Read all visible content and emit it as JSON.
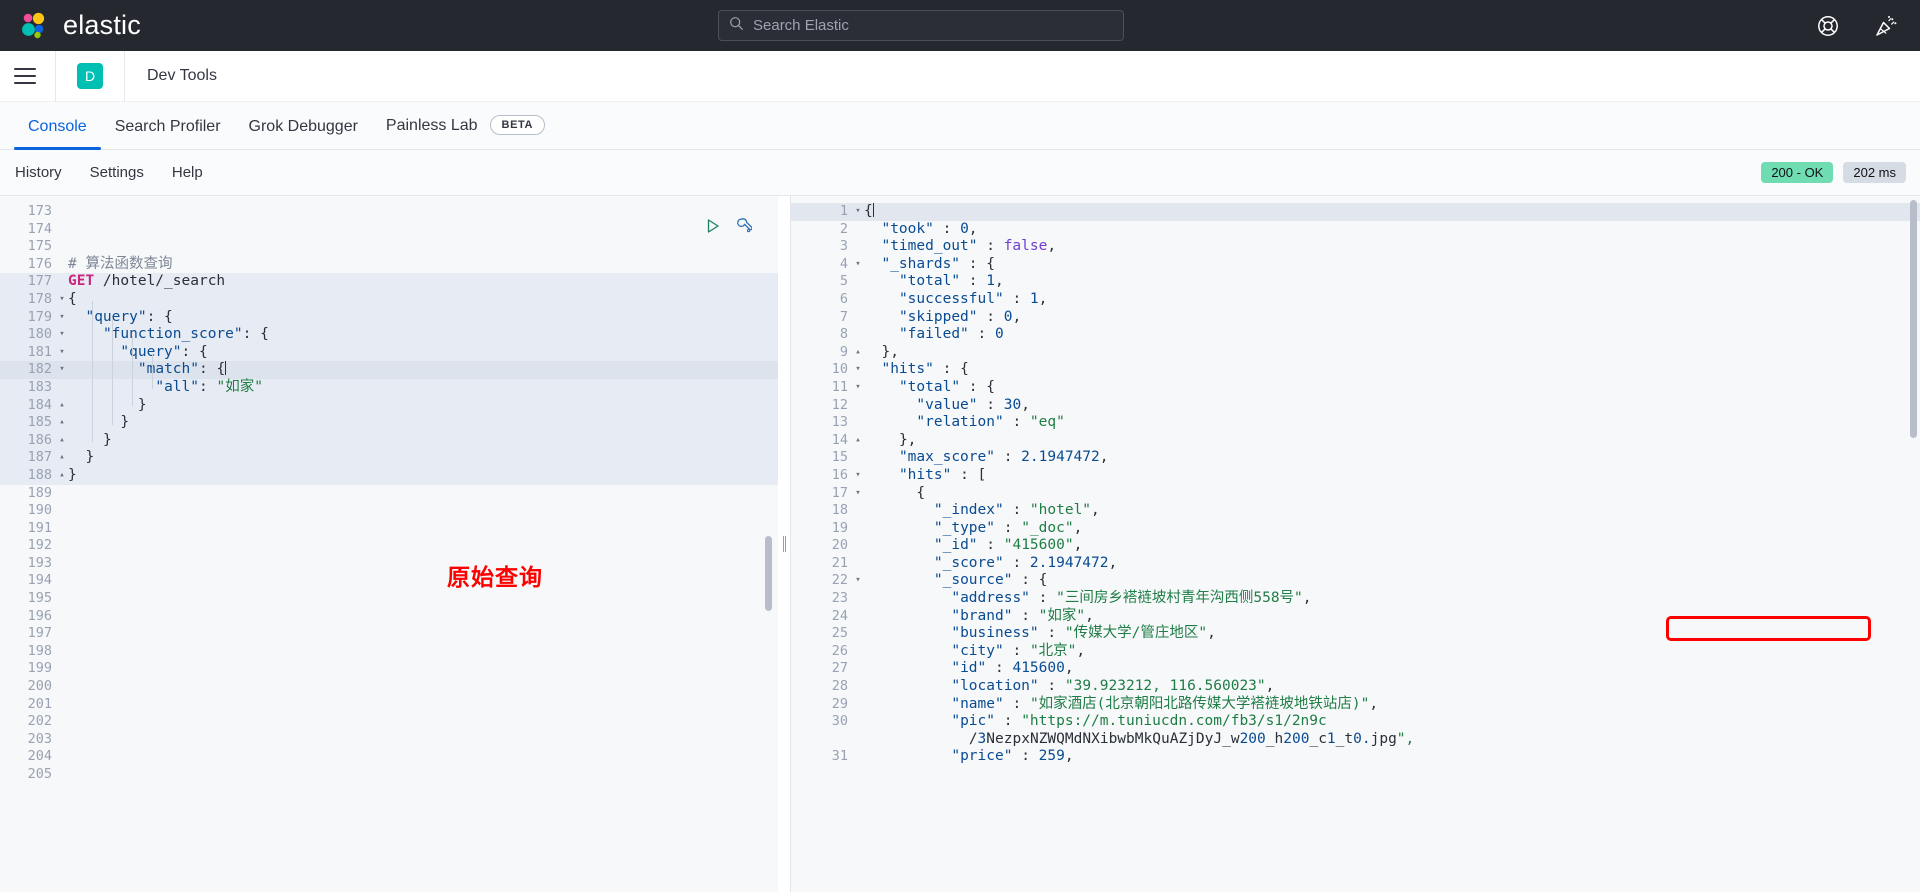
{
  "topbar": {
    "brand": "elastic",
    "search_placeholder": "Search Elastic",
    "search_value": "",
    "icons": [
      "help-lifebuoy-icon",
      "party-popper-icon"
    ]
  },
  "appbar": {
    "space_initial": "D",
    "title": "Dev Tools"
  },
  "tabs": [
    {
      "label": "Console",
      "active": true
    },
    {
      "label": "Search Profiler",
      "active": false
    },
    {
      "label": "Grok Debugger",
      "active": false
    },
    {
      "label": "Painless Lab",
      "active": false,
      "badge": "BETA"
    }
  ],
  "console_toolbar": {
    "links": [
      "History",
      "Settings",
      "Help"
    ],
    "status_badge": "200 - OK",
    "time_badge": "202 ms",
    "status_color": "#6fdcb2",
    "time_color": "#d6dce4"
  },
  "editor": {
    "first_line_number": 173,
    "lines": [
      {
        "n": 173,
        "text": "",
        "fold": "",
        "sel": false
      },
      {
        "n": 174,
        "text": "",
        "fold": "",
        "sel": false
      },
      {
        "n": 175,
        "text": "",
        "fold": "",
        "sel": false
      },
      {
        "n": 176,
        "text": "# 算法函数查询",
        "fold": "",
        "sel": false,
        "kind": "comment"
      },
      {
        "n": 177,
        "text": "GET /hotel/_search",
        "fold": "",
        "sel": true,
        "kind": "request"
      },
      {
        "n": 178,
        "text": "{",
        "fold": "down",
        "sel": true
      },
      {
        "n": 179,
        "text": "  \"query\": {",
        "fold": "down",
        "sel": true
      },
      {
        "n": 180,
        "text": "    \"function_score\": {",
        "fold": "down",
        "sel": true
      },
      {
        "n": 181,
        "text": "      \"query\": {",
        "fold": "down",
        "sel": true
      },
      {
        "n": 182,
        "text": "        \"match\": {",
        "fold": "down",
        "sel": true,
        "cursor": true
      },
      {
        "n": 183,
        "text": "          \"all\": \"如家\"",
        "fold": "",
        "sel": true
      },
      {
        "n": 184,
        "text": "        }",
        "fold": "up",
        "sel": true
      },
      {
        "n": 185,
        "text": "      }",
        "fold": "up",
        "sel": true
      },
      {
        "n": 186,
        "text": "    }",
        "fold": "up",
        "sel": true
      },
      {
        "n": 187,
        "text": "  }",
        "fold": "up",
        "sel": true
      },
      {
        "n": 188,
        "text": "}",
        "fold": "up",
        "sel": true
      },
      {
        "n": 189,
        "text": "",
        "fold": "",
        "sel": false
      },
      {
        "n": 190,
        "text": "",
        "fold": "",
        "sel": false
      },
      {
        "n": 191,
        "text": "",
        "fold": "",
        "sel": false
      },
      {
        "n": 192,
        "text": "",
        "fold": "",
        "sel": false
      },
      {
        "n": 193,
        "text": "",
        "fold": "",
        "sel": false
      },
      {
        "n": 194,
        "text": "",
        "fold": "",
        "sel": false
      },
      {
        "n": 195,
        "text": "",
        "fold": "",
        "sel": false
      },
      {
        "n": 196,
        "text": "",
        "fold": "",
        "sel": false
      },
      {
        "n": 197,
        "text": "",
        "fold": "",
        "sel": false
      },
      {
        "n": 198,
        "text": "",
        "fold": "",
        "sel": false
      },
      {
        "n": 199,
        "text": "",
        "fold": "",
        "sel": false
      },
      {
        "n": 200,
        "text": "",
        "fold": "",
        "sel": false
      },
      {
        "n": 201,
        "text": "",
        "fold": "",
        "sel": false
      },
      {
        "n": 202,
        "text": "",
        "fold": "",
        "sel": false
      },
      {
        "n": 203,
        "text": "",
        "fold": "",
        "sel": false
      },
      {
        "n": 204,
        "text": "",
        "fold": "",
        "sel": false
      },
      {
        "n": 205,
        "text": "",
        "fold": "",
        "sel": false
      }
    ],
    "run_icon": "play-icon",
    "wrench_icon": "wrench-icon"
  },
  "annotation": {
    "label": "原始查询",
    "color": "#ff0000",
    "highlight_line": 15
  },
  "response": {
    "lines": [
      {
        "n": 1,
        "fold": "down",
        "text": "{",
        "cursor": true
      },
      {
        "n": 2,
        "fold": "",
        "text": "  \"took\" : 0,"
      },
      {
        "n": 3,
        "fold": "",
        "text": "  \"timed_out\" : false,"
      },
      {
        "n": 4,
        "fold": "down",
        "text": "  \"_shards\" : {"
      },
      {
        "n": 5,
        "fold": "",
        "text": "    \"total\" : 1,"
      },
      {
        "n": 6,
        "fold": "",
        "text": "    \"successful\" : 1,"
      },
      {
        "n": 7,
        "fold": "",
        "text": "    \"skipped\" : 0,"
      },
      {
        "n": 8,
        "fold": "",
        "text": "    \"failed\" : 0"
      },
      {
        "n": 9,
        "fold": "up",
        "text": "  },"
      },
      {
        "n": 10,
        "fold": "down",
        "text": "  \"hits\" : {"
      },
      {
        "n": 11,
        "fold": "down",
        "text": "    \"total\" : {"
      },
      {
        "n": 12,
        "fold": "",
        "text": "      \"value\" : 30,"
      },
      {
        "n": 13,
        "fold": "",
        "text": "      \"relation\" : \"eq\""
      },
      {
        "n": 14,
        "fold": "up",
        "text": "    },"
      },
      {
        "n": 15,
        "fold": "",
        "text": "    \"max_score\" : 2.1947472,"
      },
      {
        "n": 16,
        "fold": "down",
        "text": "    \"hits\" : ["
      },
      {
        "n": 17,
        "fold": "down",
        "text": "      {"
      },
      {
        "n": 18,
        "fold": "",
        "text": "        \"_index\" : \"hotel\","
      },
      {
        "n": 19,
        "fold": "",
        "text": "        \"_type\" : \"_doc\","
      },
      {
        "n": 20,
        "fold": "",
        "text": "        \"_id\" : \"415600\","
      },
      {
        "n": 21,
        "fold": "",
        "text": "        \"_score\" : 2.1947472,"
      },
      {
        "n": 22,
        "fold": "down",
        "text": "        \"_source\" : {"
      },
      {
        "n": 23,
        "fold": "",
        "text": "          \"address\" : \"三间房乡褡裢坡村青年沟西侧558号\","
      },
      {
        "n": 24,
        "fold": "",
        "text": "          \"brand\" : \"如家\","
      },
      {
        "n": 25,
        "fold": "",
        "text": "          \"business\" : \"传媒大学/管庄地区\","
      },
      {
        "n": 26,
        "fold": "",
        "text": "          \"city\" : \"北京\","
      },
      {
        "n": 27,
        "fold": "",
        "text": "          \"id\" : 415600,"
      },
      {
        "n": 28,
        "fold": "",
        "text": "          \"location\" : \"39.923212, 116.560023\","
      },
      {
        "n": 29,
        "fold": "",
        "text": "          \"name\" : \"如家酒店(北京朝阳北路传媒大学褡裢坡地铁站店)\","
      },
      {
        "n": 30,
        "fold": "",
        "text": "          \"pic\" : \"https://m.tuniucdn.com/fb3/s1/2n9c"
      },
      {
        "n": "",
        "fold": "",
        "text": "            /3NezpxNZWQMdNXibwbMkQuAZjDyJ_w200_h200_c1_t0.jpg\","
      },
      {
        "n": 31,
        "fold": "",
        "text": "          \"price\" : 259,"
      }
    ]
  }
}
